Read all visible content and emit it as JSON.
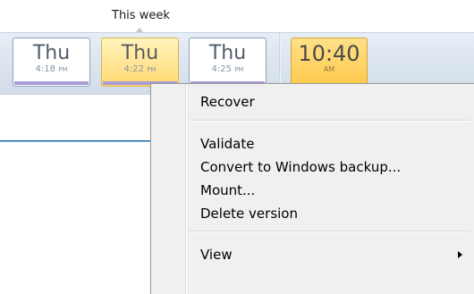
{
  "timeline": {
    "week_label": "This week",
    "versions": [
      {
        "day": "Thu",
        "time": "4:18",
        "ampm": "PM",
        "selected": false
      },
      {
        "day": "Thu",
        "time": "4:22",
        "ampm": "PM",
        "selected": true
      },
      {
        "day": "Thu",
        "time": "4:25",
        "ampm": "PM",
        "selected": false
      }
    ],
    "current": {
      "time": "10:40",
      "ampm": "AM"
    }
  },
  "context_menu": {
    "items": [
      {
        "label": "Recover"
      },
      {
        "label": "Validate"
      },
      {
        "label": "Convert to Windows backup..."
      },
      {
        "label": "Mount..."
      },
      {
        "label": "Delete version"
      },
      {
        "label": "View",
        "has_submenu": true
      }
    ]
  },
  "colors": {
    "selected_tile": "#ffd970",
    "current_tile": "#ffc94a",
    "version_bar": "#a99cd6",
    "accent_line": "#1f6aa8"
  }
}
